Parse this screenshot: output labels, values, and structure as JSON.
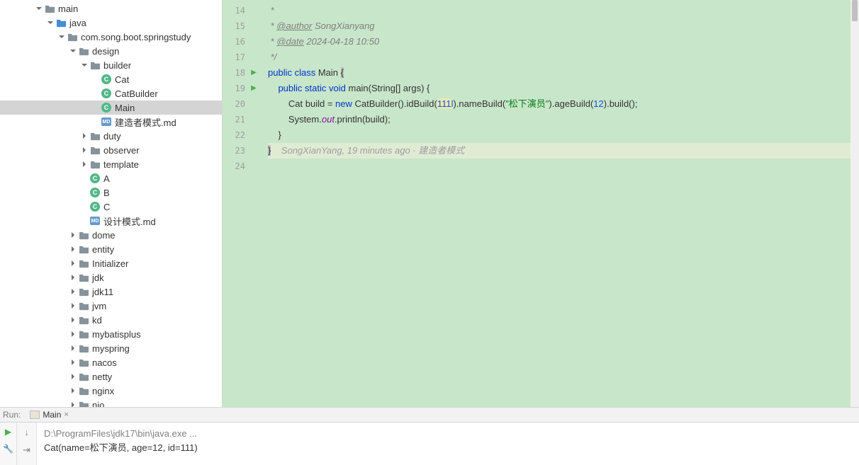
{
  "tree": [
    {
      "d": 3,
      "tw": "down",
      "ic": "folder",
      "lbl": "main",
      "open": false
    },
    {
      "d": 4,
      "tw": "down",
      "ic": "folder",
      "lbl": "java",
      "open": true
    },
    {
      "d": 5,
      "tw": "down",
      "ic": "pkg",
      "lbl": "com.song.boot.springstudy"
    },
    {
      "d": 6,
      "tw": "down",
      "ic": "pkg",
      "lbl": "design"
    },
    {
      "d": 7,
      "tw": "down",
      "ic": "pkg",
      "lbl": "builder"
    },
    {
      "d": 8,
      "tw": "",
      "ic": "class",
      "lbl": "Cat"
    },
    {
      "d": 8,
      "tw": "",
      "ic": "class",
      "lbl": "CatBuilder"
    },
    {
      "d": 8,
      "tw": "",
      "ic": "classrun",
      "lbl": "Main",
      "sel": true
    },
    {
      "d": 8,
      "tw": "",
      "ic": "md",
      "lbl": "建造者模式.md"
    },
    {
      "d": 7,
      "tw": "right",
      "ic": "pkg",
      "lbl": "duty"
    },
    {
      "d": 7,
      "tw": "right",
      "ic": "pkg",
      "lbl": "observer"
    },
    {
      "d": 7,
      "tw": "right",
      "ic": "pkg",
      "lbl": "template"
    },
    {
      "d": 7,
      "tw": "",
      "ic": "class",
      "lbl": "A"
    },
    {
      "d": 7,
      "tw": "",
      "ic": "class",
      "lbl": "B"
    },
    {
      "d": 7,
      "tw": "",
      "ic": "classrun",
      "lbl": "C"
    },
    {
      "d": 7,
      "tw": "",
      "ic": "md",
      "lbl": "设计模式.md"
    },
    {
      "d": 6,
      "tw": "right",
      "ic": "pkg",
      "lbl": "dome"
    },
    {
      "d": 6,
      "tw": "right",
      "ic": "pkg",
      "lbl": "entity"
    },
    {
      "d": 6,
      "tw": "right",
      "ic": "pkg",
      "lbl": "Initializer"
    },
    {
      "d": 6,
      "tw": "right",
      "ic": "pkg",
      "lbl": "jdk"
    },
    {
      "d": 6,
      "tw": "right",
      "ic": "pkg",
      "lbl": "jdk11"
    },
    {
      "d": 6,
      "tw": "right",
      "ic": "pkg",
      "lbl": "jvm"
    },
    {
      "d": 6,
      "tw": "right",
      "ic": "pkg",
      "lbl": "kd"
    },
    {
      "d": 6,
      "tw": "right",
      "ic": "pkg",
      "lbl": "mybatisplus"
    },
    {
      "d": 6,
      "tw": "right",
      "ic": "pkg",
      "lbl": "myspring"
    },
    {
      "d": 6,
      "tw": "right",
      "ic": "pkg",
      "lbl": "nacos"
    },
    {
      "d": 6,
      "tw": "right",
      "ic": "pkg",
      "lbl": "netty"
    },
    {
      "d": 6,
      "tw": "right",
      "ic": "pkg",
      "lbl": "nginx"
    },
    {
      "d": 6,
      "tw": "right",
      "ic": "pkg",
      "lbl": "nio"
    }
  ],
  "lineStart": 14,
  "playLines": [
    18,
    19
  ],
  "code": {
    "l14": " *",
    "l15_a": " * ",
    "l15_tag": "@author",
    "l15_b": " SongXianyang",
    "l16_a": " * ",
    "l16_tag": "@date",
    "l16_b": " 2024-04-18 10:50",
    "l17": " */",
    "l18_kw1": "public",
    "l18_kw2": "class",
    "l18_name": " Main ",
    "l18_br": "{",
    "l19_kw1": "public",
    "l19_kw2": "static",
    "l19_kw3": "void",
    "l19_m": " main",
    "l19_args": "(String[] args) {",
    "l20_a": "        Cat build = ",
    "l20_new": "new",
    "l20_b": " CatBuilder().idBuild(",
    "l20_n1": "111l",
    "l20_c": ").nameBuild(",
    "l20_s": "\"松下演员\"",
    "l20_d": ").ageBuild(",
    "l20_n2": "12",
    "l20_e": ").build();",
    "l21_a": "        System.",
    "l21_out": "out",
    "l21_b": ".println(build);",
    "l22": "    }",
    "l23_br": "}",
    "l23_lens": "    SongXianYang, 19 minutes ago · 建造者模式"
  },
  "run": {
    "label": "Run:",
    "tab": "Main",
    "cmd": "D:\\ProgramFiles\\jdk17\\bin\\java.exe ...",
    "out": "Cat(name=松下演员, age=12, id=111)"
  }
}
